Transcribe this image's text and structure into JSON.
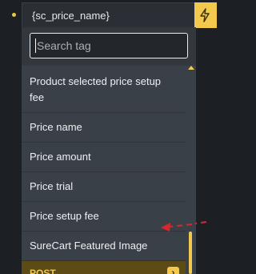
{
  "tag_field": {
    "value": "{sc_price_name}"
  },
  "dynamic_button": {
    "icon": "bolt-icon"
  },
  "search": {
    "placeholder": "Search tag",
    "value": ""
  },
  "items": [
    {
      "label": "Product selected price setup fee"
    },
    {
      "label": "Price name"
    },
    {
      "label": "Price amount"
    },
    {
      "label": "Price trial"
    },
    {
      "label": "Price setup fee"
    },
    {
      "label": "SureCart Featured Image"
    }
  ],
  "group": {
    "label": "POST",
    "icon": "chevron-right-icon"
  },
  "colors": {
    "accent": "#f2c94c",
    "annotation": "#d9262b"
  }
}
